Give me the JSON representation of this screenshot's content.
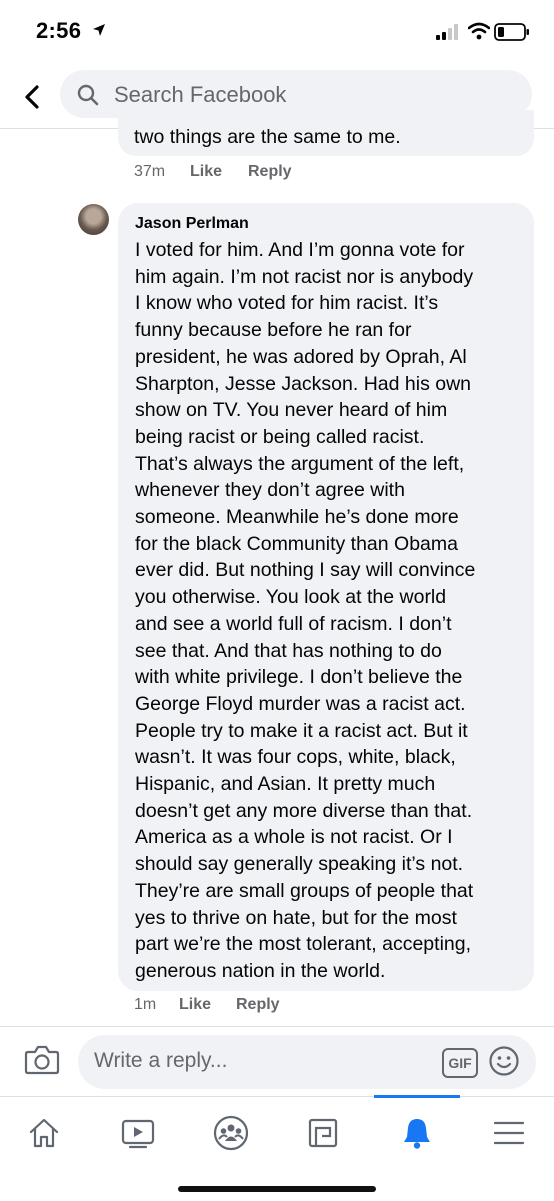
{
  "status_bar": {
    "time": "2:56"
  },
  "search": {
    "placeholder": "Search Facebook"
  },
  "previous_comment": {
    "last_line": "two things are the same to me.",
    "time": "37m",
    "like_label": "Like",
    "reply_label": "Reply"
  },
  "comment": {
    "author": "Jason Perlman",
    "lines": [
      "I voted for him.  And I’m gonna vote for",
      "him again. I’m not racist nor is anybody",
      "I know who voted for him racist. It’s",
      "funny because before he ran for",
      "president, he was adored by Oprah, Al",
      "Sharpton, Jesse Jackson. Had his own",
      "show on TV. You never heard of him",
      "being racist or being called racist.",
      "That’s always the argument of the left,",
      "whenever they don’t agree with",
      "someone. Meanwhile he’s done more",
      "for the black Community than Obama",
      "ever did. But nothing I say will convince",
      "you otherwise. You look at the world",
      "and see a world full of racism. I don’t",
      "see that. And that has nothing to do",
      "with white privilege. I don’t believe the",
      "George Floyd murder was a racist act.",
      "People try to make it a racist act. But it",
      "wasn’t. It was four cops, white, black,",
      "Hispanic, and Asian. It pretty much",
      "doesn’t get any more diverse than that.",
      "America as a whole is not racist. Or I",
      "should say generally speaking it’s not.",
      "They’re are small groups of people that",
      "yes to thrive on hate, but for the most",
      "part we’re the most tolerant, accepting,",
      "generous nation in the world."
    ],
    "time": "1m",
    "like_label": "Like",
    "reply_label": "Reply"
  },
  "reply_bar": {
    "placeholder": "Write a reply...",
    "gif_label": "GIF"
  },
  "tabs": [
    {
      "icon": "home-icon",
      "active": false
    },
    {
      "icon": "watch-video-icon",
      "active": false
    },
    {
      "icon": "groups-icon",
      "active": false
    },
    {
      "icon": "pages-icon",
      "active": false
    },
    {
      "icon": "notifications-bell-icon",
      "active": true
    },
    {
      "icon": "menu-icon",
      "active": false
    }
  ],
  "colors": {
    "accent": "#1877f2",
    "bubble": "#f0f2f5",
    "secondary_text": "#65676b"
  }
}
